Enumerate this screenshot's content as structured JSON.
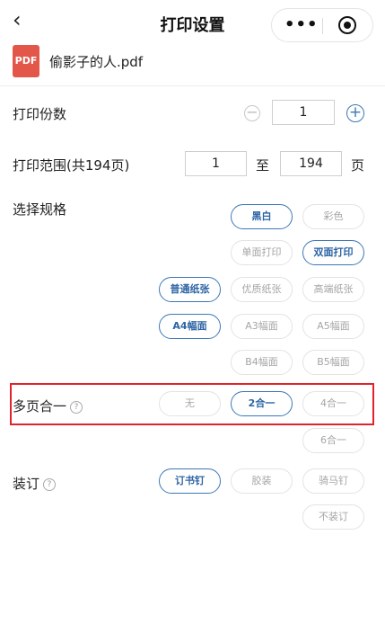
{
  "header": {
    "back_icon": "‹",
    "title": "打印设置",
    "more_icon": "•••"
  },
  "file": {
    "icon_text": "PDF",
    "name": "偷影子的人.pdf"
  },
  "copies": {
    "label": "打印份数",
    "value": "1"
  },
  "range": {
    "label": "打印范围(共194页)",
    "start": "1",
    "to": "至",
    "end": "194",
    "unit": "页"
  },
  "spec": {
    "label": "选择规格",
    "color_options": [
      "黑白",
      "彩色"
    ],
    "side_options": [
      "单面打印",
      "双面打印"
    ],
    "paper_options": [
      "普通纸张",
      "优质纸张",
      "高端纸张"
    ],
    "size_options": [
      "A4幅面",
      "A3幅面",
      "A5幅面",
      "B4幅面",
      "B5幅面"
    ]
  },
  "multipage": {
    "label": "多页合一",
    "help": "?",
    "options": [
      "无",
      "2合一",
      "4合一",
      "6合一"
    ]
  },
  "binding": {
    "label": "装订",
    "help": "?",
    "options": [
      "订书钉",
      "胶装",
      "骑马钉",
      "不装订"
    ]
  },
  "colors": {
    "accent": "#3d78b5",
    "highlight_border": "#e0242b",
    "pdf_icon": "#e3564a"
  }
}
